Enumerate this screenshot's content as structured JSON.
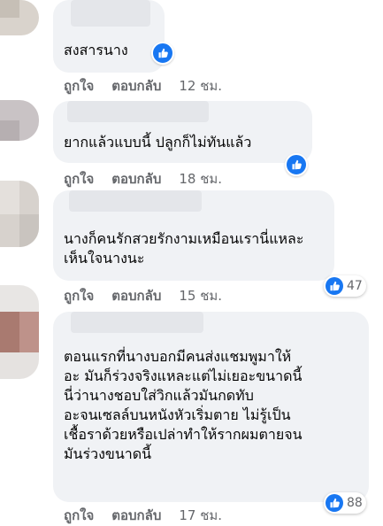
{
  "labels": {
    "like": "ถูกใจ",
    "reply": "ตอบกลับ"
  },
  "comments": [
    {
      "text": "สงสารนาง",
      "time": "12 ชม."
    },
    {
      "text": "ยากแล้วแบบนี้ ปลูกก็ไม่ทันแล้ว",
      "time": "18 ชม."
    },
    {
      "text": "นางก็คนรักสวยรักงามเหมือนเรานี่แหละ\nเห็นใจนางนะ",
      "time": "15 ชม.",
      "reactions": "47"
    },
    {
      "text": "ตอนแรกที่นางบอกมีคนส่งแชมพูมาให้\nอะ มันก็ร่วงจริงแหละแต่ไม่เยอะขนาดนี้\nนี่ว่านางชอบใส่วิกแล้วมันกดทับ\nอะจนเซลล์บนหนังหัวเริ่มตาย ไม่รู้เป็น\nเชื้อราด้วยหรือเปล่าทำให้รากผมตายจน\nมันร่วงขนาดนี้",
      "time": "17 ชม.",
      "reactions": "88"
    }
  ],
  "colors": {
    "like_blue": "#1877f2",
    "bubble_bg": "#f0f2f5",
    "meta_gray": "#65676b"
  }
}
